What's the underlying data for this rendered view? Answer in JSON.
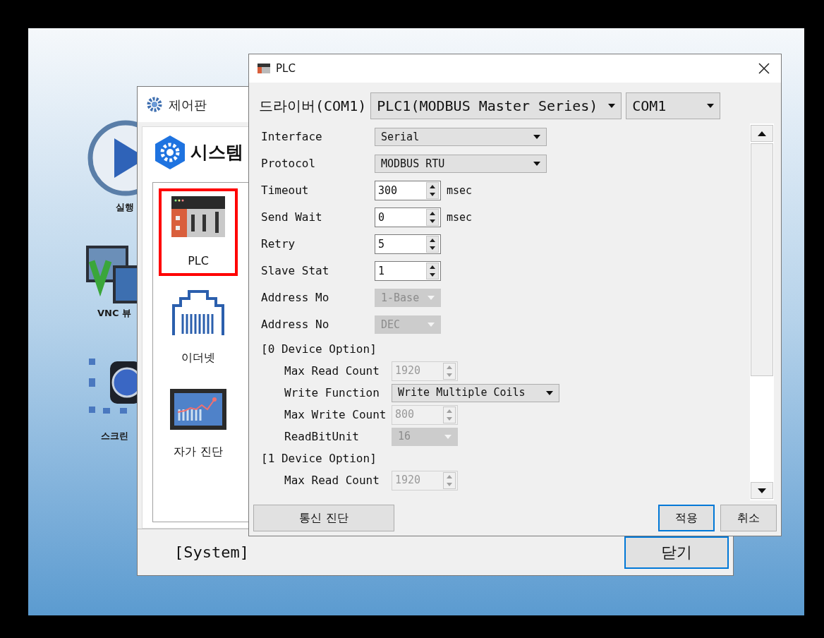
{
  "desktop": {
    "icons": [
      {
        "kind": "run",
        "label": "실행"
      },
      {
        "kind": "vnc",
        "label": "VNC 뷰"
      },
      {
        "kind": "screen",
        "label": "스크린"
      }
    ]
  },
  "control_panel": {
    "title": "제어판",
    "header": "시스템",
    "items": [
      {
        "kind": "plc",
        "label": "PLC",
        "selected": true
      },
      {
        "kind": "ethernet",
        "label": "이더넷",
        "selected": false
      },
      {
        "kind": "diagnostics",
        "label": "자가 진단",
        "selected": false
      }
    ],
    "footer": "[System]",
    "close_button": {
      "label": "닫기",
      "default": true
    }
  },
  "plc_dialog": {
    "title": "PLC",
    "driver_label": "드라이버(COM1)",
    "driver": "PLC1(MODBUS Master Series)",
    "port": "COM1",
    "fields": [
      {
        "kind": "select",
        "label": "Interface",
        "value": "Serial",
        "disabled": false
      },
      {
        "kind": "select",
        "label": "Protocol",
        "value": "MODBUS RTU",
        "disabled": false
      },
      {
        "kind": "spin",
        "label": "Timeout",
        "value": "300",
        "unit": "msec",
        "disabled": false
      },
      {
        "kind": "spin",
        "label": "Send Wait",
        "value": "0",
        "unit": "msec",
        "disabled": false
      },
      {
        "kind": "spin",
        "label": "Retry",
        "value": "5",
        "disabled": false
      },
      {
        "kind": "spin",
        "label": "Slave Stat",
        "value": "1",
        "disabled": false
      },
      {
        "kind": "select",
        "label": "Address Mo",
        "value": "1-Base",
        "disabled": true
      },
      {
        "kind": "select",
        "label": "Address No",
        "value": "DEC",
        "disabled": true
      },
      {
        "kind": "section",
        "label": "[0 Device Option]",
        "children": [
          {
            "kind": "spin",
            "label": "Max Read Count",
            "value": "1920",
            "disabled": true
          },
          {
            "kind": "select",
            "label": "Write Function",
            "value": "Write Multiple Coils",
            "disabled": false
          },
          {
            "kind": "spin",
            "label": "Max Write Count",
            "value": "800",
            "disabled": true
          },
          {
            "kind": "select",
            "label": "ReadBitUnit",
            "value": "16",
            "disabled": true
          }
        ]
      },
      {
        "kind": "section",
        "label": "[1 Device Option]",
        "children": [
          {
            "kind": "spin",
            "label": "Max Read Count",
            "value": "1920",
            "disabled": true
          }
        ]
      }
    ],
    "buttons": [
      {
        "label": "통신 진단",
        "default": false
      },
      {
        "label": "적용",
        "default": true
      },
      {
        "label": "취소",
        "default": false
      }
    ]
  }
}
